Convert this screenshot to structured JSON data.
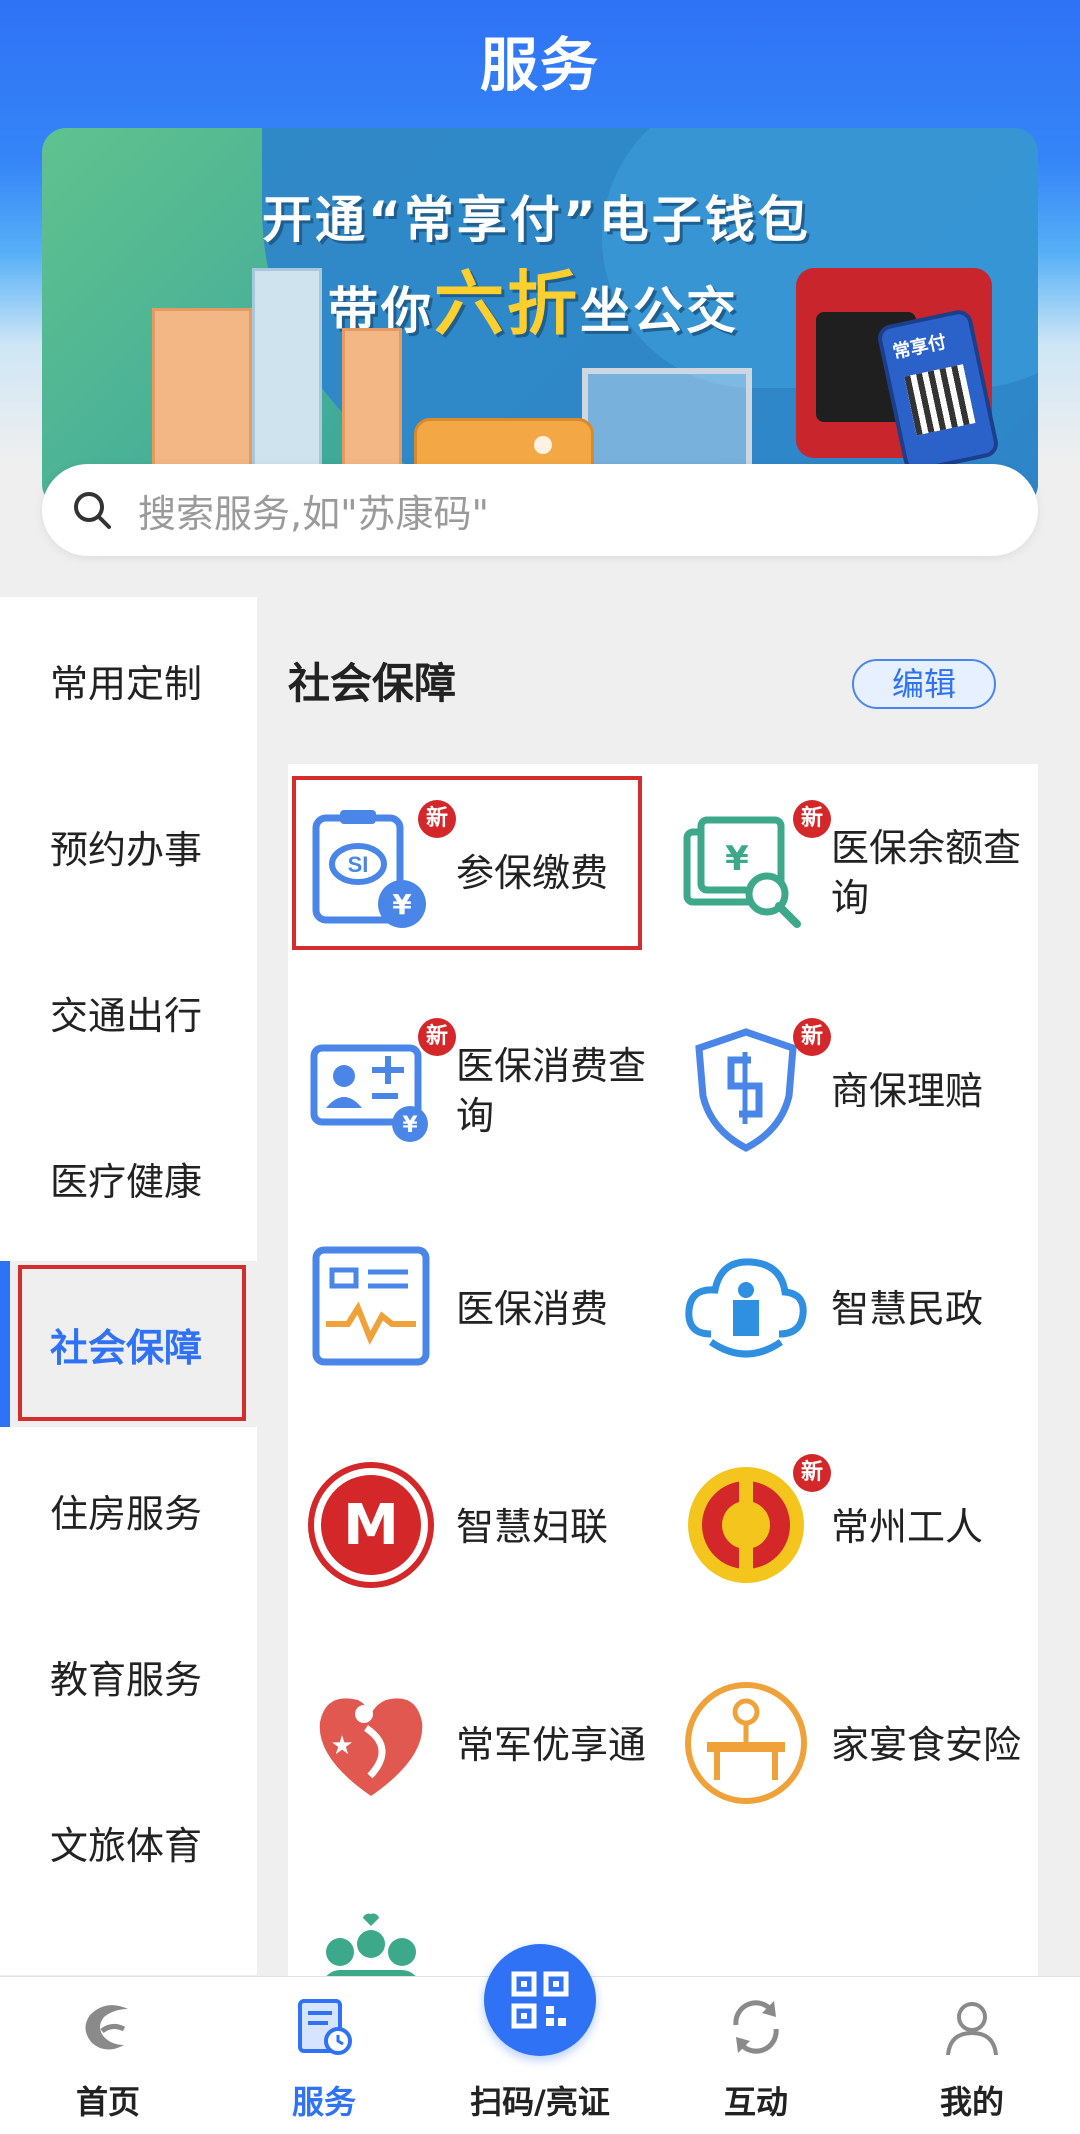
{
  "header": {
    "title": "服务"
  },
  "banner": {
    "line1": "开通“常享付”电子钱包",
    "line2_pre": "带你",
    "line2_highlight": "六折",
    "line2_post": "坐公交",
    "phone_text": "常享付"
  },
  "search": {
    "placeholder": "搜索服务,如\"苏康码\""
  },
  "sidebar": {
    "items": [
      {
        "label": "常用定制"
      },
      {
        "label": "预约办事"
      },
      {
        "label": "交通出行"
      },
      {
        "label": "医疗健康"
      },
      {
        "label": "社会保障",
        "active": true
      },
      {
        "label": "住房服务"
      },
      {
        "label": "教育服务"
      },
      {
        "label": "文旅体育"
      }
    ]
  },
  "section": {
    "title": "社会保障",
    "edit_label": "编辑"
  },
  "services": [
    {
      "label": "参保缴费",
      "icon": "social-insurance-payment-icon",
      "badge": "新"
    },
    {
      "label": "医保余额查询",
      "icon": "medical-balance-query-icon",
      "badge": "新"
    },
    {
      "label": "医保消费查询",
      "icon": "medical-consumption-query-icon",
      "badge": "新"
    },
    {
      "label": "商保理赔",
      "icon": "commercial-insurance-claim-icon",
      "badge": "新"
    },
    {
      "label": "医保消费",
      "icon": "medical-consumption-icon"
    },
    {
      "label": "智慧民政",
      "icon": "smart-civil-affairs-icon"
    },
    {
      "label": "智慧妇联",
      "icon": "smart-womens-federation-icon"
    },
    {
      "label": "常州工人",
      "icon": "changzhou-workers-icon",
      "badge": "新"
    },
    {
      "label": "常军优享通",
      "icon": "veteran-benefits-icon"
    },
    {
      "label": "家宴食安险",
      "icon": "banquet-food-safety-icon"
    }
  ],
  "tabbar": {
    "items": [
      {
        "label": "首页",
        "icon": "home-icon"
      },
      {
        "label": "服务",
        "icon": "service-icon",
        "active": true
      },
      {
        "label": "扫码/亮证",
        "icon": "qr-scan-icon"
      },
      {
        "label": "互动",
        "icon": "interaction-icon"
      },
      {
        "label": "我的",
        "icon": "profile-icon"
      }
    ]
  },
  "colors": {
    "primary": "#2f72f5",
    "badge": "#d3272a",
    "highlight_box": "#d32d2d"
  }
}
